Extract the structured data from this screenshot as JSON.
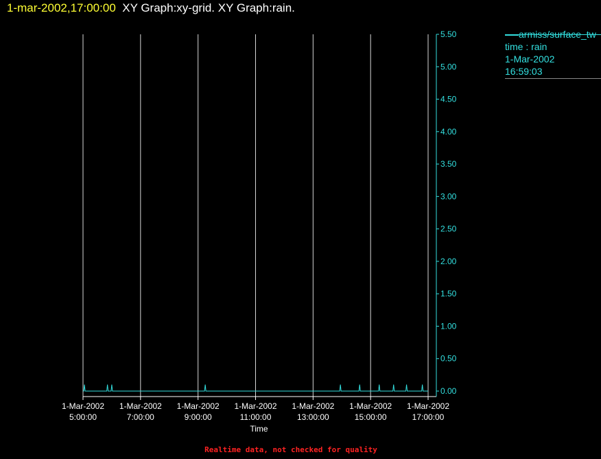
{
  "header": {
    "timestamp": "1-mar-2002,17:00:00",
    "graph_titles": "XY Graph:xy-grid.  XY Graph:rain."
  },
  "legend": {
    "series_label": "armiss/surface_tw",
    "line2": "time : rain",
    "line3": "1-Mar-2002",
    "line4": "16:59:03"
  },
  "footer": {
    "note": "Realtime data, not checked for quality"
  },
  "colors": {
    "series": "#33e0e0",
    "grid": "#d8d8d8",
    "axis_x": "#ffffff",
    "axis_y": "#33e0e0",
    "title_time": "#ffff33",
    "footer": "#ff2222"
  },
  "chart_data": {
    "type": "line",
    "xlabel": "Time",
    "ylabel": "",
    "xlim_hours": [
      5.0,
      17.0
    ],
    "ylim": [
      0,
      5.5
    ],
    "y_ticks": [
      "0.00",
      "0.50",
      "1.00",
      "1.50",
      "2.00",
      "2.50",
      "3.00",
      "3.50",
      "4.00",
      "4.50",
      "5.00",
      "5.50"
    ],
    "x_ticks": [
      {
        "date": "1-Mar-2002",
        "time": "5:00:00",
        "hour": 5
      },
      {
        "date": "1-Mar-2002",
        "time": "7:00:00",
        "hour": 7
      },
      {
        "date": "1-Mar-2002",
        "time": "9:00:00",
        "hour": 9
      },
      {
        "date": "1-Mar-2002",
        "time": "11:00:00",
        "hour": 11
      },
      {
        "date": "1-Mar-2002",
        "time": "13:00:00",
        "hour": 13
      },
      {
        "date": "1-Mar-2002",
        "time": "15:00:00",
        "hour": 15
      },
      {
        "date": "1-Mar-2002",
        "time": "17:00:00",
        "hour": 17
      }
    ],
    "grid": true,
    "legend_position": "right",
    "series": [
      {
        "name": "armiss/surface_tw",
        "baseline": 0.0,
        "spike_hours": [
          5.05,
          5.85,
          6.0,
          9.25,
          13.95,
          14.62,
          15.3,
          15.8,
          16.25,
          16.8
        ],
        "spike_value": 0.1
      }
    ]
  }
}
